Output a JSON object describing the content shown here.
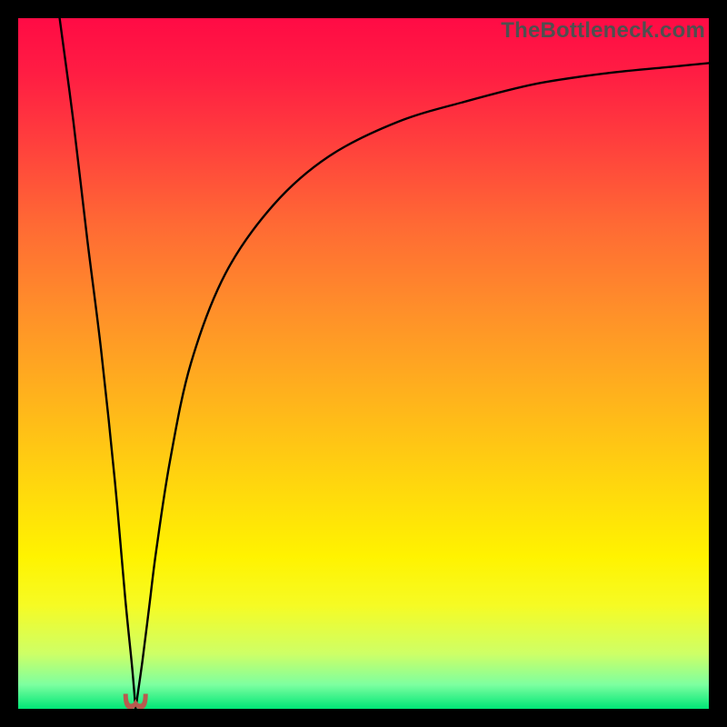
{
  "watermark": "TheBottleneck.com",
  "chart_data": {
    "type": "line",
    "title": "",
    "xlabel": "",
    "ylabel": "",
    "xlim": [
      0,
      100
    ],
    "ylim": [
      0,
      100
    ],
    "notch_x": 17,
    "left_branch": {
      "name": "left-branch",
      "description": "steep descent from upper-left into notch",
      "x": [
        6,
        8,
        10,
        12,
        14,
        15.5,
        16.5,
        17
      ],
      "y": [
        100,
        85,
        68,
        52,
        33,
        16,
        6,
        0
      ]
    },
    "right_branch": {
      "name": "right-branch",
      "description": "curve rising from notch toward upper-right, concave down",
      "x": [
        17,
        18,
        19,
        20,
        22,
        25,
        30,
        37,
        45,
        55,
        65,
        75,
        85,
        95,
        100
      ],
      "y": [
        0,
        7,
        15,
        23,
        36,
        50,
        63,
        73,
        80,
        85,
        88,
        90.5,
        92,
        93,
        93.5
      ]
    },
    "marker": {
      "description": "small rounded U-shaped red-brown marker at the notch minimum",
      "x": 17,
      "y": 0,
      "color": "#b85a4e"
    },
    "gradient_stops": [
      {
        "offset": 0.0,
        "color": "#ff0b45"
      },
      {
        "offset": 0.08,
        "color": "#ff1d43"
      },
      {
        "offset": 0.18,
        "color": "#ff3f3d"
      },
      {
        "offset": 0.3,
        "color": "#ff6a34"
      },
      {
        "offset": 0.42,
        "color": "#ff8e2a"
      },
      {
        "offset": 0.55,
        "color": "#ffb31c"
      },
      {
        "offset": 0.68,
        "color": "#ffd80d"
      },
      {
        "offset": 0.78,
        "color": "#fff300"
      },
      {
        "offset": 0.85,
        "color": "#f6fb24"
      },
      {
        "offset": 0.92,
        "color": "#ceff66"
      },
      {
        "offset": 0.965,
        "color": "#7dffa0"
      },
      {
        "offset": 1.0,
        "color": "#00e676"
      }
    ]
  }
}
